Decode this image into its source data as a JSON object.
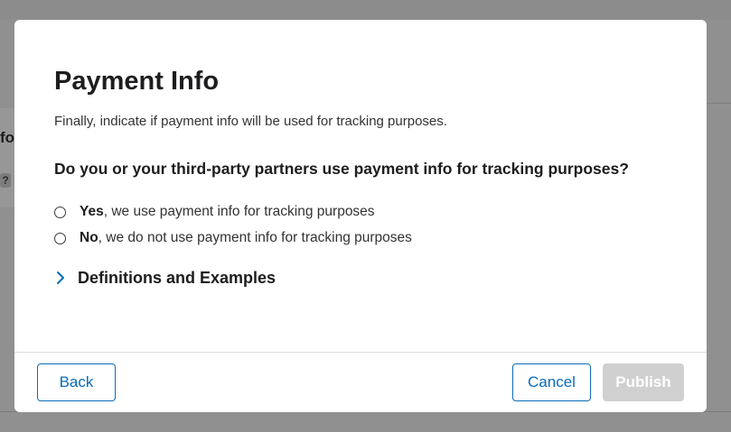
{
  "background": {
    "partial_text": "fo",
    "help_badge": "?"
  },
  "modal": {
    "title": "Payment Info",
    "subtitle": "Finally, indicate if payment info will be used for tracking purposes.",
    "question": "Do you or your third-party partners use payment info for tracking purposes?",
    "options": [
      {
        "bold": "Yes",
        "rest": ", we use payment info for tracking purposes",
        "selected": false
      },
      {
        "bold": "No",
        "rest": ", we do not use payment info for tracking purposes",
        "selected": false
      }
    ],
    "definitions_label": "Definitions and Examples",
    "definitions_expanded": false
  },
  "footer": {
    "back_label": "Back",
    "cancel_label": "Cancel",
    "publish_label": "Publish",
    "publish_enabled": false
  },
  "colors": {
    "accent": "#0a6cb7",
    "disabled_button": "#d0d0d0",
    "overlay": "#909090"
  },
  "icons": {
    "definitions_toggle": "chevron-right-icon"
  }
}
